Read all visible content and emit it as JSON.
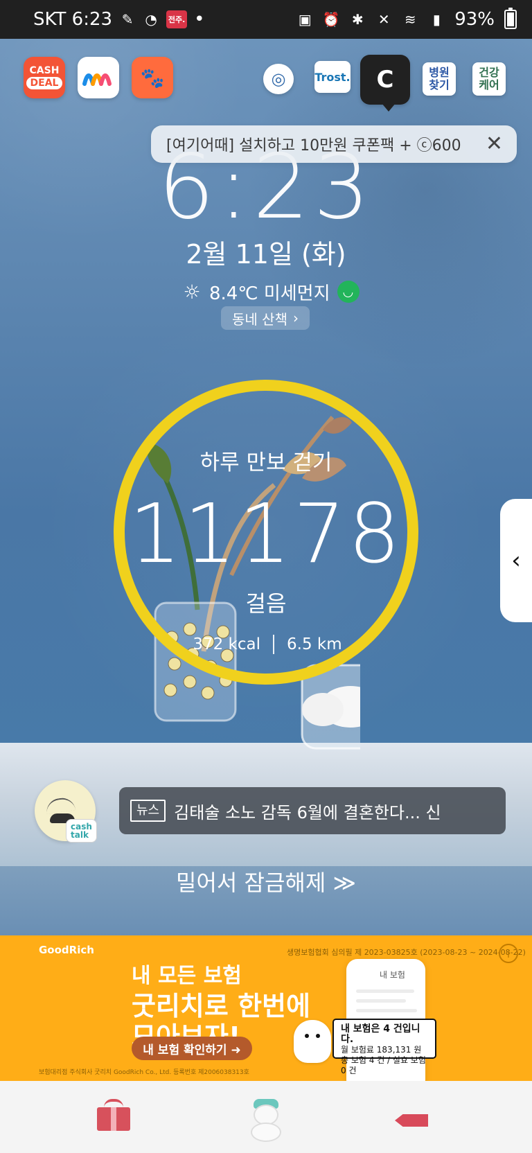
{
  "status_bar": {
    "carrier_time": "SKT 6:23",
    "mini_badge": "전주.",
    "dot": "•",
    "battery": "93%"
  },
  "apps": {
    "cashdeal_top": "CASH",
    "cashdeal_bottom": "DEAL",
    "trost": "Trost.",
    "c_letter": "C",
    "hospital_line1": "병원",
    "hospital_line2": "찾기",
    "health_line1": "건강",
    "health_line2": "케어"
  },
  "notification": {
    "text": "[여기어때] 설치하고 10만원 쿠폰팩 + ⓒ600",
    "close": "✕"
  },
  "lockscreen": {
    "clock": "6:23",
    "date": "2월 11일 (화)",
    "weather": "8.4℃ 미세먼지",
    "walk_button": "동네 산책"
  },
  "steps": {
    "title": "하루 만보 걷기",
    "count": "11178",
    "unit": "걸음",
    "kcal": "372 kcal",
    "distance": "6.5 km"
  },
  "cashtalk": {
    "label": "cash talk"
  },
  "news": {
    "tag": "뉴스",
    "headline": "김태술 소노 감독 6월에 결혼한다... 신"
  },
  "unlock": {
    "text": "밀어서 잠금해제 ≫"
  },
  "ad": {
    "brand": "GoodRich",
    "small_notice": "생명보험협회 심의필 제 2023-03825호 (2023-08-23 ~ 2024-08-22)",
    "headline_1": "내 모든 보험",
    "headline_2": "굿리치로 한번에",
    "headline_3": "모아보자!",
    "button": "내 보험 확인하기 ➜",
    "footer": "보험대리점 주식회사 굿리치 GoodRich Co., Ltd. 등록번호 제2006038313호",
    "phone_title": "내 보험",
    "bubble_main": "내 보험은 4 건입니다.",
    "bubble_sub1": "월 보험료 183,131 원",
    "bubble_sub2": "총 보험 4 건 / 실효 보험 0 건",
    "info": "i"
  }
}
